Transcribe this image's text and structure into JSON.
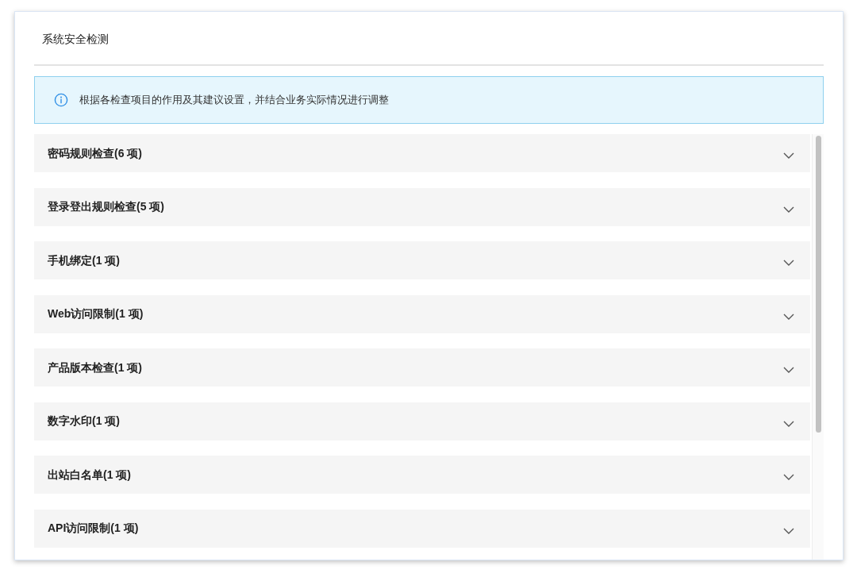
{
  "title": "系统安全检测",
  "notice": "根据各检查项目的作用及其建议设置，并结合业务实际情况进行调整",
  "sections": [
    {
      "label": "密码规则检查(6 项)",
      "expanded": false
    },
    {
      "label": "登录登出规则检查(5 项)",
      "expanded": false
    },
    {
      "label": "手机绑定(1 项)",
      "expanded": false
    },
    {
      "label": "Web访问限制(1 项)",
      "expanded": false
    },
    {
      "label": "产品版本检查(1 项)",
      "expanded": false
    },
    {
      "label": "数字水印(1 项)",
      "expanded": false
    },
    {
      "label": "出站白名单(1 项)",
      "expanded": false
    },
    {
      "label": "API访问限制(1 项)",
      "expanded": false
    }
  ]
}
